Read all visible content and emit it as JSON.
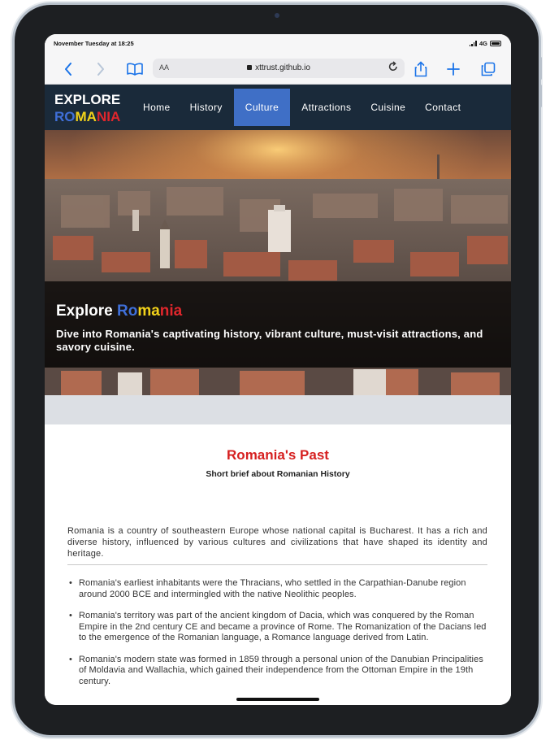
{
  "status_bar": {
    "time": "November Tuesday at 18:25",
    "network": "4G"
  },
  "browser": {
    "text_size_label": "AA",
    "url": "xttrust.github.io",
    "icons": [
      "back-icon",
      "forward-icon",
      "bookmarks-icon",
      "lock-icon",
      "reload-icon",
      "share-icon",
      "new-tab-icon",
      "tabs-icon"
    ]
  },
  "site": {
    "logo_line1": "EXPLORE",
    "logo_line2": [
      "RO",
      "MA",
      "NIA"
    ],
    "logo_colors": [
      "#3f6fd8",
      "#f2d21a",
      "#e0262c"
    ],
    "nav": [
      {
        "label": "Home",
        "active": false
      },
      {
        "label": "History",
        "active": false
      },
      {
        "label": "Culture",
        "active": true
      },
      {
        "label": "Attractions",
        "active": false
      },
      {
        "label": "Cuisine",
        "active": false
      },
      {
        "label": "Contact",
        "active": false
      }
    ]
  },
  "hero": {
    "title_prefix": "Explore ",
    "title_parts": [
      "Ro",
      "ma",
      "nia"
    ],
    "subtitle": "Dive into Romania's captivating history, vibrant culture, must-visit attractions, and savory cuisine."
  },
  "section": {
    "title": "Romania's Past",
    "subtitle": "Short brief about Romanian History",
    "intro": "Romania is a country of southeastern Europe whose national capital is Bucharest. It has a rich and diverse history, influenced by various cultures and civilizations that have shaped its identity and heritage.",
    "facts": [
      "Romania's earliest inhabitants were the Thracians, who settled in the Carpathian-Danube region around 2000 BCE and intermingled with the native Neolithic peoples.",
      "Romania's territory was part of the ancient kingdom of Dacia, which was conquered by the Roman Empire in the 2nd century CE and became a province of Rome. The Romanization of the Dacians led to the emergence of the Romanian language, a Romance language derived from Latin.",
      "Romania's modern state was formed in 1859 through a personal union of the Danubian Principalities of Moldavia and Wallachia, which gained their independence from the Ottoman Empire in the 19th century."
    ]
  }
}
